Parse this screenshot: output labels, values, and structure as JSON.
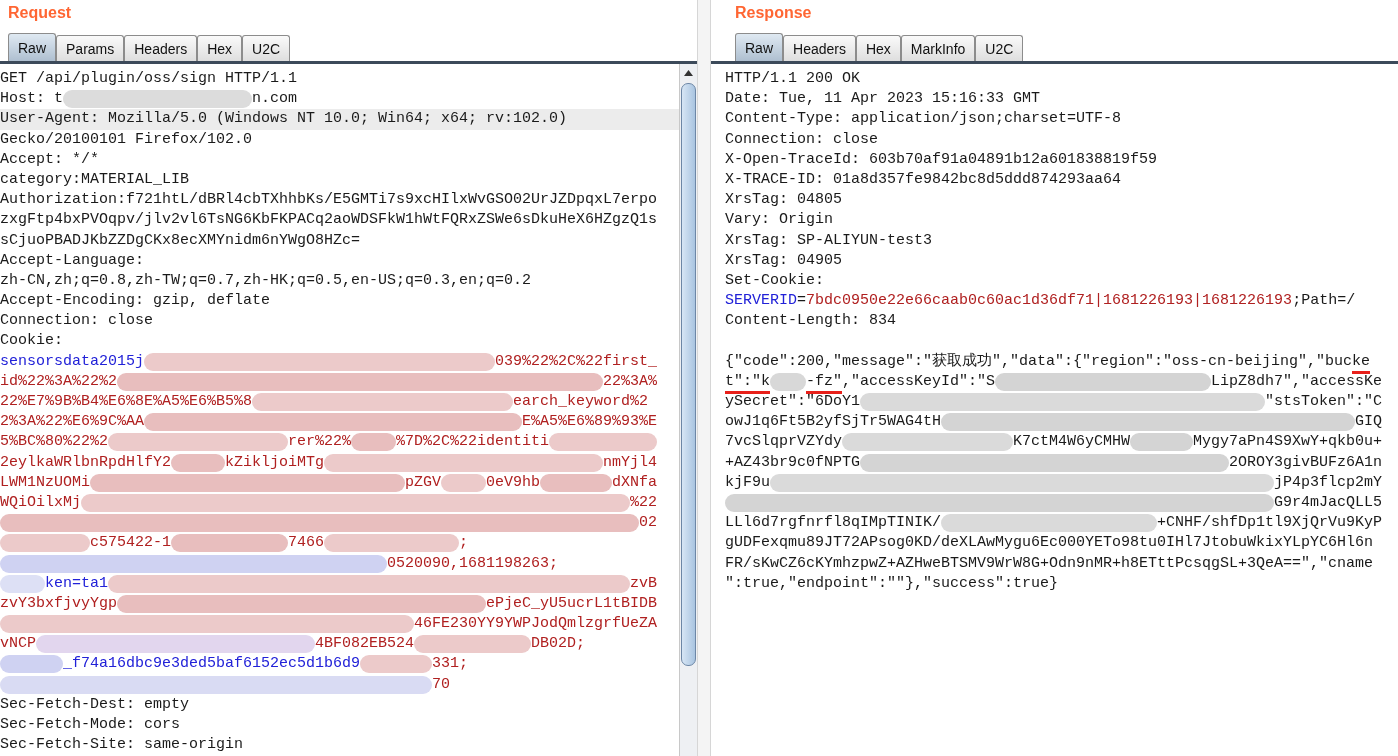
{
  "panes": [
    {
      "title": "Request",
      "scrollbar": true,
      "tabs": [
        {
          "label": "Raw",
          "selected": true
        },
        {
          "label": "Params",
          "selected": false
        },
        {
          "label": "Headers",
          "selected": false
        },
        {
          "label": "Hex",
          "selected": false
        },
        {
          "label": "U2C",
          "selected": false
        }
      ],
      "lines": [
        {
          "highlighted": false,
          "parts": [
            {
              "kind": "plain",
              "text": "GET /api/plugin/oss/sign HTTP/1.1"
            }
          ]
        },
        {
          "highlighted": false,
          "parts": [
            {
              "kind": "plain",
              "text": "Host: t"
            },
            {
              "kind": "hidden",
              "color": "#dcdcdc"
            },
            {
              "kind": "plain",
              "text": "n.com"
            }
          ]
        },
        {
          "highlighted": true,
          "parts": [
            {
              "kind": "plain",
              "text": "User-Agent: Mozilla/5.0 (Windows NT 10.0; Win64; x64; rv:102.0)"
            }
          ]
        },
        {
          "highlighted": false,
          "parts": [
            {
              "kind": "plain",
              "text": "Gecko/20100101 Firefox/102.0"
            }
          ]
        },
        {
          "highlighted": false,
          "parts": [
            {
              "kind": "plain",
              "text": "Accept: */*"
            }
          ]
        },
        {
          "highlighted": false,
          "parts": [
            {
              "kind": "plain",
              "text": "category:MATERIAL_LIB"
            }
          ]
        },
        {
          "highlighted": false,
          "parts": [
            {
              "kind": "plain",
              "text": "Authorization:f721htL/dBRl4cbTXhhbKs/E5GMTi7s9xcHIlxWvGSO02UrJZDpqxL7erpo"
            }
          ]
        },
        {
          "highlighted": false,
          "parts": [
            {
              "kind": "plain",
              "text": "zxgFtp4bxPVOqpv/jlv2vl6TsNG6KbFKPACq2aoWDSFkW1hWtFQRxZSWe6sDkuHeX6HZgzQ1s"
            }
          ]
        },
        {
          "highlighted": false,
          "parts": [
            {
              "kind": "plain",
              "text": "sCjuoPBADJKbZZDgCKx8ecXMYnidm6nYWgO8HZc="
            }
          ]
        },
        {
          "highlighted": false,
          "parts": [
            {
              "kind": "plain",
              "text": "Accept-Language:"
            }
          ]
        },
        {
          "highlighted": false,
          "parts": [
            {
              "kind": "plain",
              "text": "zh-CN,zh;q=0.8,zh-TW;q=0.7,zh-HK;q=0.5,en-US;q=0.3,en;q=0.2"
            }
          ]
        },
        {
          "highlighted": false,
          "parts": [
            {
              "kind": "plain",
              "text": "Accept-Encoding: gzip, deflate"
            }
          ]
        },
        {
          "highlighted": false,
          "parts": [
            {
              "kind": "plain",
              "text": "Connection: close"
            }
          ]
        },
        {
          "highlighted": false,
          "parts": [
            {
              "kind": "plain",
              "text": "Cookie:"
            }
          ]
        },
        {
          "highlighted": false,
          "parts": [
            {
              "kind": "name",
              "text": "sensorsdata2015j"
            },
            {
              "kind": "hidden",
              "color": "#eccaca"
            },
            {
              "kind": "value",
              "text": "039%22%2C%22first_"
            }
          ]
        },
        {
          "highlighted": false,
          "parts": [
            {
              "kind": "value",
              "text": "id%22%3A%22%2"
            },
            {
              "kind": "hidden",
              "color": "#e8bebe"
            },
            {
              "kind": "value",
              "text": "22%3A%"
            }
          ]
        },
        {
          "highlighted": false,
          "parts": [
            {
              "kind": "value",
              "text": "22%E7%9B%B4%E6%8E%A5%E6%B5%8"
            },
            {
              "kind": "hidden",
              "color": "#eccaca"
            },
            {
              "kind": "value",
              "text": "earch_keyword%2"
            }
          ]
        },
        {
          "highlighted": false,
          "parts": [
            {
              "kind": "value",
              "text": "2%3A%22%E6%9C%AA"
            },
            {
              "kind": "hidden",
              "color": "#e8bebe"
            },
            {
              "kind": "value",
              "text": "E%A5%E6%89%93%E"
            }
          ]
        },
        {
          "highlighted": false,
          "parts": [
            {
              "kind": "value",
              "text": "5%BC%80%22%2"
            },
            {
              "kind": "hidden",
              "color": "#eccaca"
            },
            {
              "kind": "value",
              "text": "rer%22%"
            },
            {
              "kind": "hidden",
              "color": "#e8bebe"
            },
            {
              "kind": "value",
              "text": "%7D%2C%22identiti"
            },
            {
              "kind": "hidden",
              "color": "#eccaca"
            }
          ]
        },
        {
          "highlighted": false,
          "parts": [
            {
              "kind": "value",
              "text": "2eylkaWRlbnRpdHlfY2"
            },
            {
              "kind": "hidden",
              "color": "#e8bebe"
            },
            {
              "kind": "value",
              "text": "kZikljoiMTg"
            },
            {
              "kind": "hidden",
              "color": "#eccaca"
            },
            {
              "kind": "value",
              "text": "nmYjl4"
            }
          ]
        },
        {
          "highlighted": false,
          "parts": [
            {
              "kind": "value",
              "text": "LWM1NzUOMi"
            },
            {
              "kind": "hidden",
              "color": "#e8bebe"
            },
            {
              "kind": "value",
              "text": "pZGV"
            },
            {
              "kind": "hidden",
              "color": "#eccaca"
            },
            {
              "kind": "value",
              "text": "0eV9hb"
            },
            {
              "kind": "hidden",
              "color": "#e8bebe"
            },
            {
              "kind": "value",
              "text": "dXNfa"
            }
          ]
        },
        {
          "highlighted": false,
          "parts": [
            {
              "kind": "value",
              "text": "WQiOilxMj"
            },
            {
              "kind": "hidden",
              "color": "#eccaca"
            },
            {
              "kind": "value",
              "text": "%22"
            }
          ]
        },
        {
          "highlighted": false,
          "parts": [
            {
              "kind": "hidden",
              "color": "#e8bebe"
            },
            {
              "kind": "value",
              "text": "02"
            }
          ]
        },
        {
          "highlighted": false,
          "parts": [
            {
              "kind": "hidden",
              "color": "#eccaca"
            },
            {
              "kind": "value",
              "text": "c575422-1"
            },
            {
              "kind": "hidden",
              "color": "#e8bebe"
            },
            {
              "kind": "value",
              "text": "7466"
            },
            {
              "kind": "hidden",
              "color": "#eccaca"
            },
            {
              "kind": "value",
              "text": ";"
            }
          ]
        },
        {
          "highlighted": false,
          "parts": [
            {
              "kind": "hidden",
              "color": "#cfd2f2"
            },
            {
              "kind": "value",
              "text": "0520090,1681198263;"
            }
          ]
        },
        {
          "highlighted": false,
          "parts": [
            {
              "kind": "hidden",
              "color": "#dde0f5"
            },
            {
              "kind": "name",
              "text": "ken=ta1"
            },
            {
              "kind": "hidden",
              "color": "#eccaca"
            },
            {
              "kind": "value",
              "text": "zvB"
            }
          ]
        },
        {
          "highlighted": false,
          "parts": [
            {
              "kind": "value",
              "text": "zvY3bxfjvyYgp"
            },
            {
              "kind": "hidden",
              "color": "#e8bebe"
            },
            {
              "kind": "value",
              "text": "ePjeC_yU5ucrL1tBIDB"
            }
          ]
        },
        {
          "highlighted": false,
          "parts": [
            {
              "kind": "hidden",
              "color": "#eccaca"
            },
            {
              "kind": "value",
              "text": "46FE230YY9YWPJodQmlzgrfUeZA"
            }
          ]
        },
        {
          "highlighted": false,
          "parts": [
            {
              "kind": "value",
              "text": "vNCP"
            },
            {
              "kind": "hidden",
              "color": "#e2d6ee"
            },
            {
              "kind": "value",
              "text": "4BF082EB524"
            },
            {
              "kind": "hidden",
              "color": "#eccaca"
            },
            {
              "kind": "value",
              "text": "DB02D;"
            }
          ]
        },
        {
          "highlighted": false,
          "parts": [
            {
              "kind": "hidden",
              "color": "#cfd2f2"
            },
            {
              "kind": "name",
              "text": "_f74a16dbc9e3ded5baf6152ec5d1b6d9"
            },
            {
              "kind": "hidden",
              "color": "#eccaca"
            },
            {
              "kind": "value",
              "text": "331;"
            }
          ]
        },
        {
          "highlighted": false,
          "parts": [
            {
              "kind": "hidden",
              "color": "#d9dbf3"
            },
            {
              "kind": "value",
              "text": "70"
            }
          ]
        },
        {
          "highlighted": false,
          "parts": [
            {
              "kind": "plain",
              "text": "Sec-Fetch-Dest: empty"
            }
          ]
        },
        {
          "highlighted": false,
          "parts": [
            {
              "kind": "plain",
              "text": "Sec-Fetch-Mode: cors"
            }
          ]
        },
        {
          "highlighted": false,
          "parts": [
            {
              "kind": "plain",
              "text": "Sec-Fetch-Site: same-origin"
            }
          ]
        }
      ]
    },
    {
      "title": "Response",
      "scrollbar": false,
      "tabs": [
        {
          "label": "Raw",
          "selected": true
        },
        {
          "label": "Headers",
          "selected": false
        },
        {
          "label": "Hex",
          "selected": false
        },
        {
          "label": "MarkInfo",
          "selected": false
        },
        {
          "label": "U2C",
          "selected": false
        }
      ],
      "lines": [
        {
          "highlighted": false,
          "parts": [
            {
              "kind": "plain",
              "text": "HTTP/1.1 200 OK"
            }
          ]
        },
        {
          "highlighted": false,
          "parts": [
            {
              "kind": "plain",
              "text": "Date: Tue, 11 Apr 2023 15:16:33 GMT"
            }
          ]
        },
        {
          "highlighted": false,
          "parts": [
            {
              "kind": "plain",
              "text": "Content-Type: application/json;charset=UTF-8"
            }
          ]
        },
        {
          "highlighted": false,
          "parts": [
            {
              "kind": "plain",
              "text": "Connection: close"
            }
          ]
        },
        {
          "highlighted": false,
          "parts": [
            {
              "kind": "plain",
              "text": "X-Open-TraceId: 603b70af91a04891b12a601838819f59"
            }
          ]
        },
        {
          "highlighted": false,
          "parts": [
            {
              "kind": "plain",
              "text": "X-TRACE-ID: 01a8d357fe9842bc8d5ddd874293aa64"
            }
          ]
        },
        {
          "highlighted": false,
          "parts": [
            {
              "kind": "plain",
              "text": "XrsTag: 04805"
            }
          ]
        },
        {
          "highlighted": false,
          "parts": [
            {
              "kind": "plain",
              "text": "Vary: Origin"
            }
          ]
        },
        {
          "highlighted": false,
          "parts": [
            {
              "kind": "plain",
              "text": "XrsTag: SP-ALIYUN-test3"
            }
          ]
        },
        {
          "highlighted": false,
          "parts": [
            {
              "kind": "plain",
              "text": "XrsTag: 04905"
            }
          ]
        },
        {
          "highlighted": false,
          "parts": [
            {
              "kind": "plain",
              "text": "Set-Cookie:"
            }
          ]
        },
        {
          "highlighted": false,
          "parts": [
            {
              "kind": "name",
              "text": "SERVERID"
            },
            {
              "kind": "plain",
              "text": "="
            },
            {
              "kind": "value",
              "text": "7bdc0950e22e66caab0c60ac1d36df71|1681226193|1681226193"
            },
            {
              "kind": "plain",
              "text": ";Path=/"
            }
          ]
        },
        {
          "highlighted": false,
          "parts": [
            {
              "kind": "plain",
              "text": "Content-Length: 834"
            }
          ]
        }
      ],
      "body": [
        {
          "highlighted": false,
          "parts": [
            {
              "kind": "plain",
              "text": "{\"code\":200,\"message\":\"获取成功\",\"data\":{\"region\":\"oss-cn-beijing\",\"buc"
            },
            {
              "kind": "plain",
              "text": "ke",
              "underlined": true
            }
          ]
        },
        {
          "highlighted": false,
          "parts": [
            {
              "kind": "plain",
              "text": "t\":\"k",
              "underlined": true
            },
            {
              "kind": "hidden",
              "color": "#d8d8d8"
            },
            {
              "kind": "plain",
              "text": "-fz\"",
              "underlined": true
            },
            {
              "kind": "plain",
              "text": ",\"accessKeyId\":\"S"
            },
            {
              "kind": "hidden",
              "color": "#d4d4d4"
            },
            {
              "kind": "plain",
              "text": "LipZ8dh7\",\"accessKe"
            }
          ]
        },
        {
          "highlighted": false,
          "parts": [
            {
              "kind": "plain",
              "text": "ySecret\":\"6DoY1"
            },
            {
              "kind": "hidden",
              "color": "#dadada"
            },
            {
              "kind": "plain",
              "text": "\"stsToken\":\"C"
            }
          ]
        },
        {
          "highlighted": false,
          "parts": [
            {
              "kind": "plain",
              "text": "owJ1q6Ft5B2yfSjTr5WAG4tH"
            },
            {
              "kind": "hidden",
              "color": "#d4d4d4"
            },
            {
              "kind": "plain",
              "text": "GIQ"
            }
          ]
        },
        {
          "highlighted": false,
          "parts": [
            {
              "kind": "plain",
              "text": "7vcSlqprVZYdy"
            },
            {
              "kind": "hidden",
              "color": "#dadada"
            },
            {
              "kind": "plain",
              "text": "K7ctM4W6yCMHW"
            },
            {
              "kind": "hidden",
              "color": "#d4d4d4"
            },
            {
              "kind": "plain",
              "text": "Mygy7aPn4S9XwY+qkb0u+"
            }
          ]
        },
        {
          "highlighted": false,
          "parts": [
            {
              "kind": "plain",
              "text": "+AZ43br9c0fNPTG"
            },
            {
              "kind": "hidden",
              "color": "#d4d4d4"
            },
            {
              "kind": "plain",
              "text": "2OROY3givBUFz6A1n"
            }
          ]
        },
        {
          "highlighted": false,
          "parts": [
            {
              "kind": "plain",
              "text": "kjF9u"
            },
            {
              "kind": "hidden",
              "color": "#dadada"
            },
            {
              "kind": "plain",
              "text": "jP4p3flcp2mY"
            }
          ]
        },
        {
          "highlighted": false,
          "parts": [
            {
              "kind": "hidden",
              "color": "#d4d4d4"
            },
            {
              "kind": "plain",
              "text": "G9r4mJacQLL5"
            }
          ]
        },
        {
          "highlighted": false,
          "parts": [
            {
              "kind": "plain",
              "text": "LLl6d7rgfnrfl8qIMpTINIK/"
            },
            {
              "kind": "hidden",
              "color": "#dadada"
            },
            {
              "kind": "plain",
              "text": "+CNHF/shfDp1tl9XjQrVu9KyP"
            }
          ]
        },
        {
          "highlighted": false,
          "parts": [
            {
              "kind": "plain",
              "text": "gUDFexqmu89JT72APsog0KD/deXLAwMygu6Ec000YETo98tu0IHl7JtobuWkixYLpYC6Hl6n"
            }
          ]
        },
        {
          "highlighted": false,
          "parts": [
            {
              "kind": "plain",
              "text": "FR/sKwCZ6cKYmhzpwZ+AZHweBTSMV9WrW8G+Odn9nMR+h8ETttPcsqgSL+3QeA==\",\"cname"
            }
          ]
        },
        {
          "highlighted": false,
          "parts": [
            {
              "kind": "plain",
              "text": "\":true,\"endpoint\":\"\"},\"success\":true}"
            }
          ]
        }
      ]
    }
  ]
}
